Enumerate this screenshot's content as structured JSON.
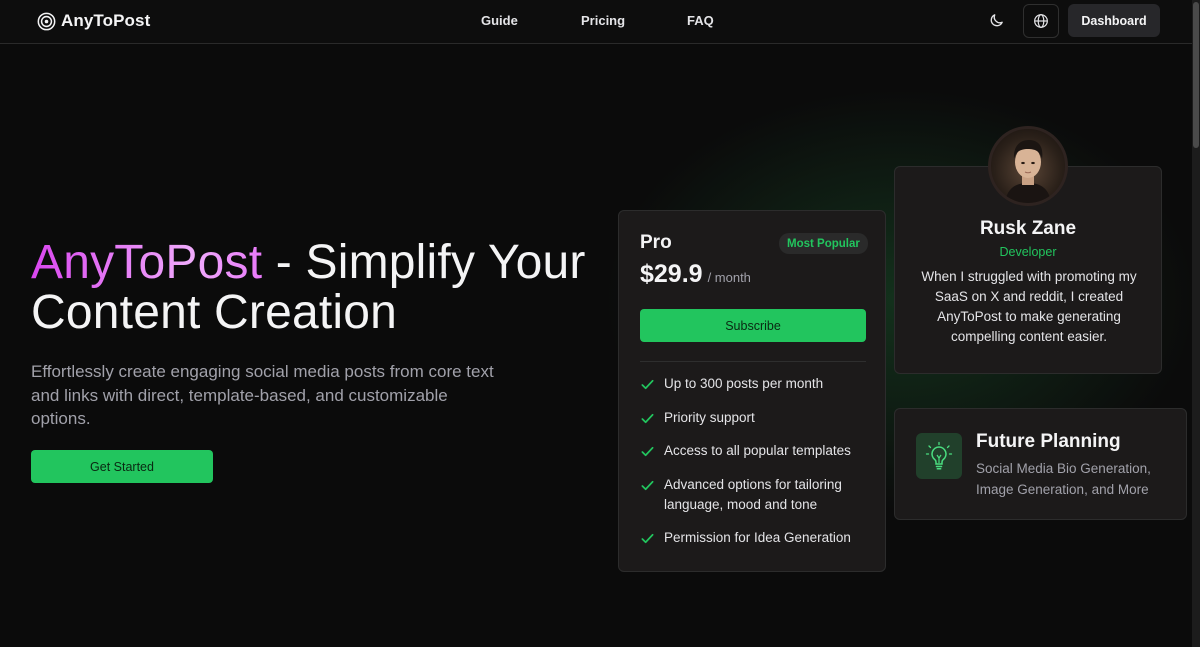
{
  "header": {
    "logo_text": "AnyToPost",
    "nav": [
      "Guide",
      "Pricing",
      "FAQ"
    ],
    "dashboard_label": "Dashboard"
  },
  "hero": {
    "title_brand": "AnyToPost",
    "title_rest": " - Simplify Your Content Creation",
    "subtitle": "Effortlessly create engaging social media posts from core text and links with direct, template-based, and customizable options.",
    "cta_label": "Get Started"
  },
  "pricing": {
    "plan": "Pro",
    "badge": "Most Popular",
    "price": "$29.9",
    "period": "/ month",
    "subscribe_label": "Subscribe",
    "features": [
      "Up to 300 posts per month",
      "Priority support",
      "Access to all popular templates",
      "Advanced options for tailoring language, mood and tone",
      "Permission for Idea Generation"
    ]
  },
  "testimonial": {
    "name": "Rusk Zane",
    "role": "Developer",
    "quote": "When I struggled with promoting my SaaS on X and reddit, I created AnyToPost to make generating compelling content easier."
  },
  "future": {
    "title": "Future Planning",
    "description": "Social Media Bio Generation, Image Generation, and More"
  },
  "colors": {
    "accent": "#22c55e",
    "brand_gradient_start": "#d946ef",
    "brand_gradient_end": "#f0abfc",
    "background": "#0b0b0b",
    "card": "#1c1a1a"
  },
  "icons": [
    "logo-target-icon",
    "moon-icon",
    "globe-icon",
    "check-icon",
    "lightbulb-icon"
  ]
}
